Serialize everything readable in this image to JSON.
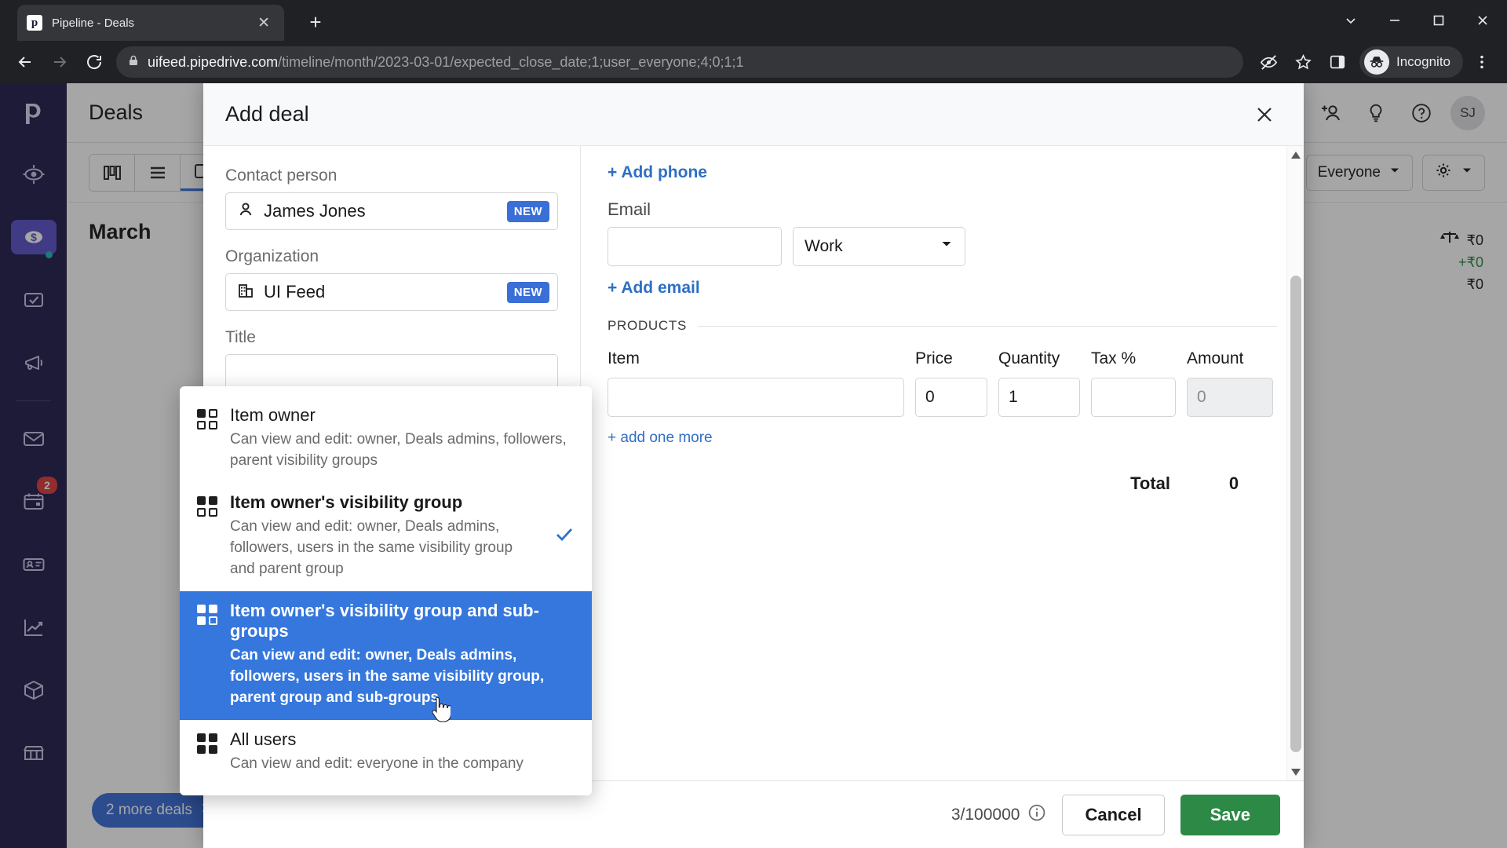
{
  "browser": {
    "tab": {
      "title": "Pipeline - Deals",
      "favicon": "pipedrive-logo-icon",
      "close_icon": "close-icon"
    },
    "new_tab_icon": "plus-icon",
    "window_controls": [
      "chevron-down-icon",
      "minimize-icon",
      "maximize-icon",
      "close-icon"
    ],
    "nav": {
      "back_icon": "back-arrow-icon",
      "forward_icon": "forward-arrow-icon",
      "reload_icon": "reload-icon"
    },
    "omnibox": {
      "lock_icon": "lock-icon",
      "host": "uifeed.pipedrive.com",
      "path": "/timeline/month/2023-03-01/expected_close_date;1;user_everyone;4;0;1;1"
    },
    "toolbar_icons": [
      "eye-slash-icon",
      "star-icon",
      "side-panel-icon"
    ],
    "profile": {
      "label": "Incognito",
      "icon": "incognito-icon"
    },
    "menu_icon": "kebab-menu-icon"
  },
  "sidebar": {
    "logo": "pipedrive-logo-icon",
    "items": [
      {
        "name": "leads",
        "icon": "target-icon",
        "active": false,
        "badge": ""
      },
      {
        "name": "deals",
        "icon": "dollar-circle-icon",
        "active": true,
        "badge": ""
      },
      {
        "name": "activities",
        "icon": "checkbox-icon",
        "active": false,
        "badge": ""
      },
      {
        "name": "campaigns",
        "icon": "megaphone-icon",
        "active": false,
        "badge": ""
      },
      {
        "name": "mail",
        "icon": "envelope-icon",
        "active": false,
        "badge": ""
      },
      {
        "name": "calendar",
        "icon": "calendar-icon",
        "active": false,
        "badge": "2"
      },
      {
        "name": "contacts",
        "icon": "contact-card-icon",
        "active": false,
        "badge": ""
      },
      {
        "name": "insights",
        "icon": "line-chart-icon",
        "active": false,
        "badge": ""
      },
      {
        "name": "products",
        "icon": "box-icon",
        "active": false,
        "badge": ""
      },
      {
        "name": "marketplace",
        "icon": "storefront-icon",
        "active": false,
        "badge": ""
      }
    ]
  },
  "deals_page": {
    "title": "Deals",
    "header_icons": [
      "add-people-icon",
      "lightbulb-icon",
      "help-circle-icon"
    ],
    "avatar_initials": "SJ",
    "view_buttons": [
      "pipeline-view-icon",
      "list-view-icon",
      "timeline-view-icon"
    ],
    "filter_everyone": "Everyone",
    "settings_icon": "gear-icon",
    "month_label": "March",
    "stats": {
      "scale_icon": "scales-icon",
      "weighted_value": "₹0",
      "added_value": "+₹0",
      "total_value": "₹0"
    },
    "more_deals_label": "2 more deals"
  },
  "modal": {
    "title": "Add deal",
    "close_icon": "close-icon",
    "left": {
      "contact_person_label": "Contact person",
      "contact_person_value": "James Jones",
      "contact_person_icon": "person-icon",
      "contact_person_badge": "NEW",
      "organization_label": "Organization",
      "organization_value": "UI Feed",
      "organization_icon": "building-icon",
      "organization_badge": "NEW",
      "title_label": "Title",
      "title_value": "",
      "visibility_selected": "Item owner's visibility group",
      "visibility_icon": "grid-2x2-icon",
      "visibility_chevron": "chevron-down-icon"
    },
    "right": {
      "add_phone_label": "+ Add phone",
      "email_label": "Email",
      "email_value": "",
      "email_type_value": "Work",
      "email_type_chevron": "chevron-down-icon",
      "add_email_label": "+ Add email",
      "products_section_label": "PRODUCTS",
      "product_columns": [
        "Item",
        "Price",
        "Quantity",
        "Tax %",
        "Amount"
      ],
      "product_row": {
        "item": "",
        "price": "0",
        "quantity": "1",
        "tax": "",
        "amount": "0"
      },
      "add_one_more_label": "+ add one more",
      "total_label": "Total",
      "total_value": "0"
    },
    "dropdown": {
      "options": [
        {
          "title": "Item owner",
          "desc": "Can view and edit: owner, Deals admins, followers, parent visibility groups",
          "icon": "grid-2x2-icon",
          "filled": [
            true,
            false,
            false,
            false
          ],
          "selected": false,
          "highlighted": false
        },
        {
          "title": "Item owner's visibility group",
          "desc": "Can view and edit: owner, Deals admins, followers, users in the same visibility group and parent group",
          "icon": "grid-2x2-icon",
          "filled": [
            true,
            true,
            false,
            false
          ],
          "selected": true,
          "highlighted": false
        },
        {
          "title": "Item owner's visibility group and sub-groups",
          "desc": "Can view and edit: owner, Deals admins, followers, users in the same visibility group, parent group and sub-groups",
          "icon": "grid-2x2-icon",
          "filled": [
            true,
            true,
            true,
            false
          ],
          "selected": false,
          "highlighted": true
        },
        {
          "title": "All users",
          "desc": "Can view and edit: everyone in the company",
          "icon": "grid-2x2-icon",
          "filled": [
            true,
            true,
            true,
            true
          ],
          "selected": false,
          "highlighted": false
        }
      ],
      "check_icon": "check-icon"
    },
    "footer": {
      "char_count": "3/100000",
      "info_icon": "info-circle-icon",
      "cancel_label": "Cancel",
      "save_label": "Save"
    },
    "scrollbar": {
      "up_icon": "caret-up-icon",
      "down_icon": "caret-down-icon"
    }
  },
  "colors": {
    "brand_purple": "#23204e",
    "accent_blue": "#3577dc",
    "save_green": "#2c8a46",
    "badge_red": "#e03b3b"
  }
}
